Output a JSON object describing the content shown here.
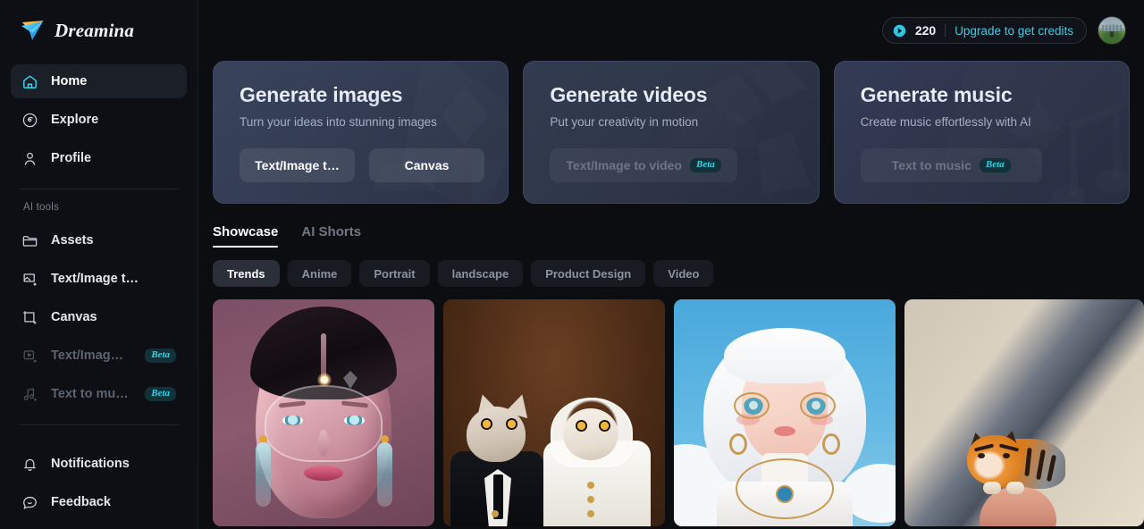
{
  "brand": {
    "name": "Dreamina",
    "logo_icon": "dreamina-arrow-logo"
  },
  "sidebar": {
    "section_label": "AI tools",
    "primary": [
      {
        "label": "Home",
        "icon": "home-icon",
        "active": true,
        "muted": false
      },
      {
        "label": "Explore",
        "icon": "compass-icon",
        "active": false,
        "muted": false
      },
      {
        "label": "Profile",
        "icon": "user-icon",
        "active": false,
        "muted": false
      }
    ],
    "tools": [
      {
        "label": "Assets",
        "icon": "folder-icon",
        "muted": false,
        "badge": ""
      },
      {
        "label": "Text/Image t…",
        "icon": "image-ai-icon",
        "muted": false,
        "badge": ""
      },
      {
        "label": "Canvas",
        "icon": "canvas-icon",
        "muted": false,
        "badge": ""
      },
      {
        "label": "Text/Image t…",
        "icon": "video-ai-icon",
        "muted": true,
        "badge": "Beta"
      },
      {
        "label": "Text to music",
        "icon": "music-ai-icon",
        "muted": true,
        "badge": "Beta"
      }
    ],
    "footer": [
      {
        "label": "Notifications",
        "icon": "bell-icon",
        "muted": false
      },
      {
        "label": "Feedback",
        "icon": "comment-icon",
        "muted": false
      }
    ]
  },
  "topbar": {
    "credits_icon": "coin-icon",
    "credits": "220",
    "upgrade_label": "Upgrade to get credits",
    "avatar_icon": "user-avatar-photo"
  },
  "hero_cards": [
    {
      "title": "Generate images",
      "subtitle": "Turn your ideas into stunning images",
      "buttons": [
        {
          "label": "Text/Image t…",
          "badge": "",
          "disabled": false
        },
        {
          "label": "Canvas",
          "badge": "",
          "disabled": false
        }
      ]
    },
    {
      "title": "Generate videos",
      "subtitle": "Put your creativity in motion",
      "buttons": [
        {
          "label": "Text/Image to video",
          "badge": "Beta",
          "disabled": true
        }
      ]
    },
    {
      "title": "Generate music",
      "subtitle": "Create music effortlessly with AI",
      "buttons": [
        {
          "label": "Text to music",
          "badge": "Beta",
          "disabled": true
        }
      ]
    }
  ],
  "tabs": [
    {
      "label": "Showcase",
      "active": true
    },
    {
      "label": "AI Shorts",
      "active": false
    }
  ],
  "chips": [
    {
      "label": "Trends",
      "active": true
    },
    {
      "label": "Anime",
      "active": false
    },
    {
      "label": "Portrait",
      "active": false
    },
    {
      "label": "landscape",
      "active": false
    },
    {
      "label": "Product Design",
      "active": false
    },
    {
      "label": "Video",
      "active": false
    }
  ],
  "gallery": [
    {
      "alt": "chrome glass woman portrait with crystal earrings on mauve background"
    },
    {
      "alt": "two cats dressed as bride and groom on brown backdrop"
    },
    {
      "alt": "3d illustrated girl with white bob hair and glasses in blue sky with clouds"
    },
    {
      "alt": "miniature tiger sitting on a human fingertip"
    }
  ],
  "colors": {
    "accent_cyan": "#3ecbe0",
    "beta_text": "#2fd3e8",
    "beta_bg": "#123138",
    "sidebar_bg": "#0d0f14",
    "page_bg": "#0b0d11",
    "card_bg": "#333c52"
  }
}
